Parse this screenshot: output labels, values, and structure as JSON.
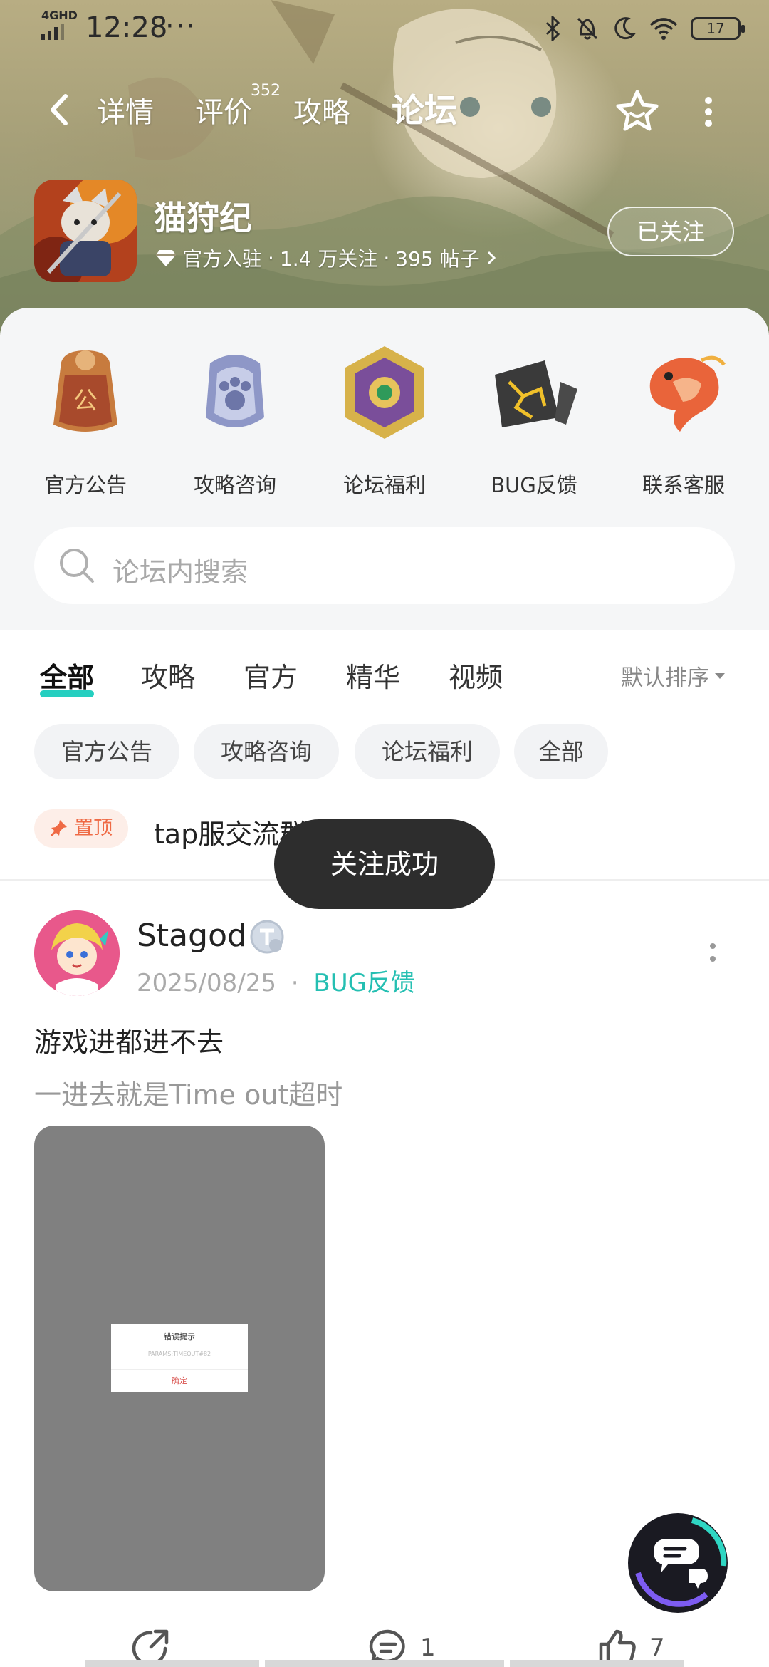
{
  "status_bar": {
    "time": "12:28",
    "network": "4GHD",
    "dots": "···",
    "battery": "17"
  },
  "nav": {
    "tabs": [
      {
        "label": "详情",
        "active": false
      },
      {
        "label": "评价",
        "active": false,
        "badge": "352"
      },
      {
        "label": "攻略",
        "active": false
      },
      {
        "label": "论坛",
        "active": true
      }
    ]
  },
  "game": {
    "title": "猫狩纪",
    "official": "官方入驻",
    "followers": "1.4 万关注",
    "posts": "395 帖子",
    "sep": "·",
    "follow_label": "已关注"
  },
  "quick_links": [
    {
      "label": "官方公告",
      "icon": "seal-icon"
    },
    {
      "label": "攻略咨询",
      "icon": "paw-badge-icon"
    },
    {
      "label": "论坛福利",
      "icon": "gem-medal-icon"
    },
    {
      "label": "BUG反馈",
      "icon": "broken-stone-icon"
    },
    {
      "label": "联系客服",
      "icon": "koi-fish-icon"
    }
  ],
  "search": {
    "placeholder": "论坛内搜索"
  },
  "filter_tabs": [
    {
      "label": "全部",
      "active": true
    },
    {
      "label": "攻略",
      "active": false
    },
    {
      "label": "官方",
      "active": false
    },
    {
      "label": "精华",
      "active": false
    },
    {
      "label": "视频",
      "active": false
    }
  ],
  "sort": {
    "label": "默认排序"
  },
  "chips": [
    "官方公告",
    "攻略咨询",
    "论坛福利",
    "全部"
  ],
  "pinned": {
    "badge": "置顶",
    "text": "tap服交流群点这里加"
  },
  "toast": "关注成功",
  "post": {
    "author": "Stagod",
    "date": "2025/08/25",
    "sep": "·",
    "category": "BUG反馈",
    "title": "游戏进都进不去",
    "body": "一进去就是Time out超时",
    "image_dialog": {
      "title": "错误提示",
      "code": "PARAMS:TIMEOUT#82",
      "button": "确定"
    },
    "comments": "1",
    "likes": "7"
  },
  "colors": {
    "accent": "#25cfc0",
    "pin": "#ef6a45",
    "toast": "#2d2d2d"
  }
}
